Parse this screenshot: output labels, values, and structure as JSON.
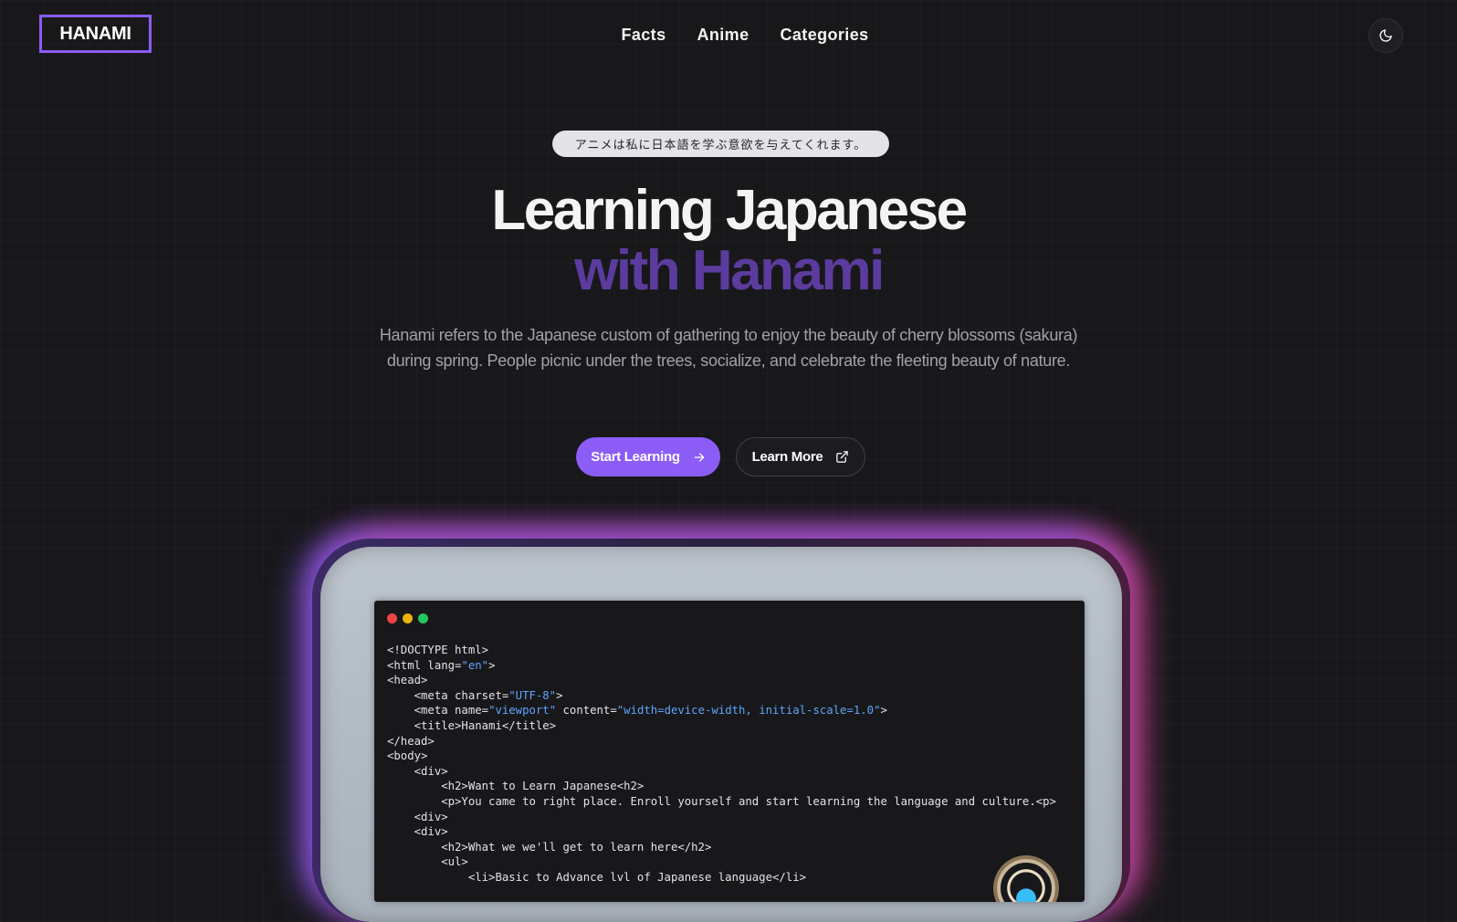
{
  "header": {
    "logo": "HANAMI",
    "nav": [
      "Facts",
      "Anime",
      "Categories"
    ]
  },
  "hero": {
    "badge": "アニメは私に日本語を学ぶ意欲を与えてくれます。",
    "title_line1": "Learning Japanese",
    "title_line2": "with Hanami",
    "description": "Hanami refers to the Japanese custom of gathering to enjoy the beauty of cherry blossoms (sakura) during spring. People picnic under the trees, socialize, and celebrate the fleeting beauty of nature.",
    "primary_button": "Start Learning",
    "secondary_button": "Learn More"
  },
  "editor": {
    "code_lines": [
      [
        [
          "<!DOCTYPE html>",
          ""
        ]
      ],
      [
        [
          "<html lang=",
          ""
        ],
        [
          "\"en\"",
          "str"
        ],
        [
          ">",
          ""
        ]
      ],
      [
        [
          "<head>",
          ""
        ]
      ],
      [
        [
          "    <meta charset=",
          ""
        ],
        [
          "\"UTF-8\"",
          "str"
        ],
        [
          ">",
          ""
        ]
      ],
      [
        [
          "    <meta name=",
          ""
        ],
        [
          "\"viewport\"",
          "str"
        ],
        [
          " content=",
          ""
        ],
        [
          "\"width=device-width, initial-scale=1.0\"",
          "str"
        ],
        [
          ">",
          ""
        ]
      ],
      [
        [
          "    <title>Hanami</title>",
          ""
        ]
      ],
      [
        [
          "</head>",
          ""
        ]
      ],
      [
        [
          "<body>",
          ""
        ]
      ],
      [
        [
          "    <div>",
          ""
        ]
      ],
      [
        [
          "        <h2>Want to Learn Japanese<h2>",
          ""
        ]
      ],
      [
        [
          "        <p>You came to right place. Enroll yourself and start learning the language and culture.<p>",
          ""
        ]
      ],
      [
        [
          "    <div>",
          ""
        ]
      ],
      [
        [
          "    <div>",
          ""
        ]
      ],
      [
        [
          "        <h2>What we we'll get to learn here</h2>",
          ""
        ]
      ],
      [
        [
          "        <ul>",
          ""
        ]
      ],
      [
        [
          "            <li>Basic to Advance lvl of Japanese language</li>",
          ""
        ]
      ]
    ],
    "dot_colors": [
      "#ef4444",
      "#eab308",
      "#22c55e"
    ]
  },
  "colors": {
    "accent": "#8b5cf6",
    "title_accent": "#5b3c9e",
    "background": "#18181b"
  },
  "icons": {
    "theme_toggle": "moon-icon",
    "primary_button": "arrow-right-icon",
    "secondary_button": "external-link-icon"
  }
}
